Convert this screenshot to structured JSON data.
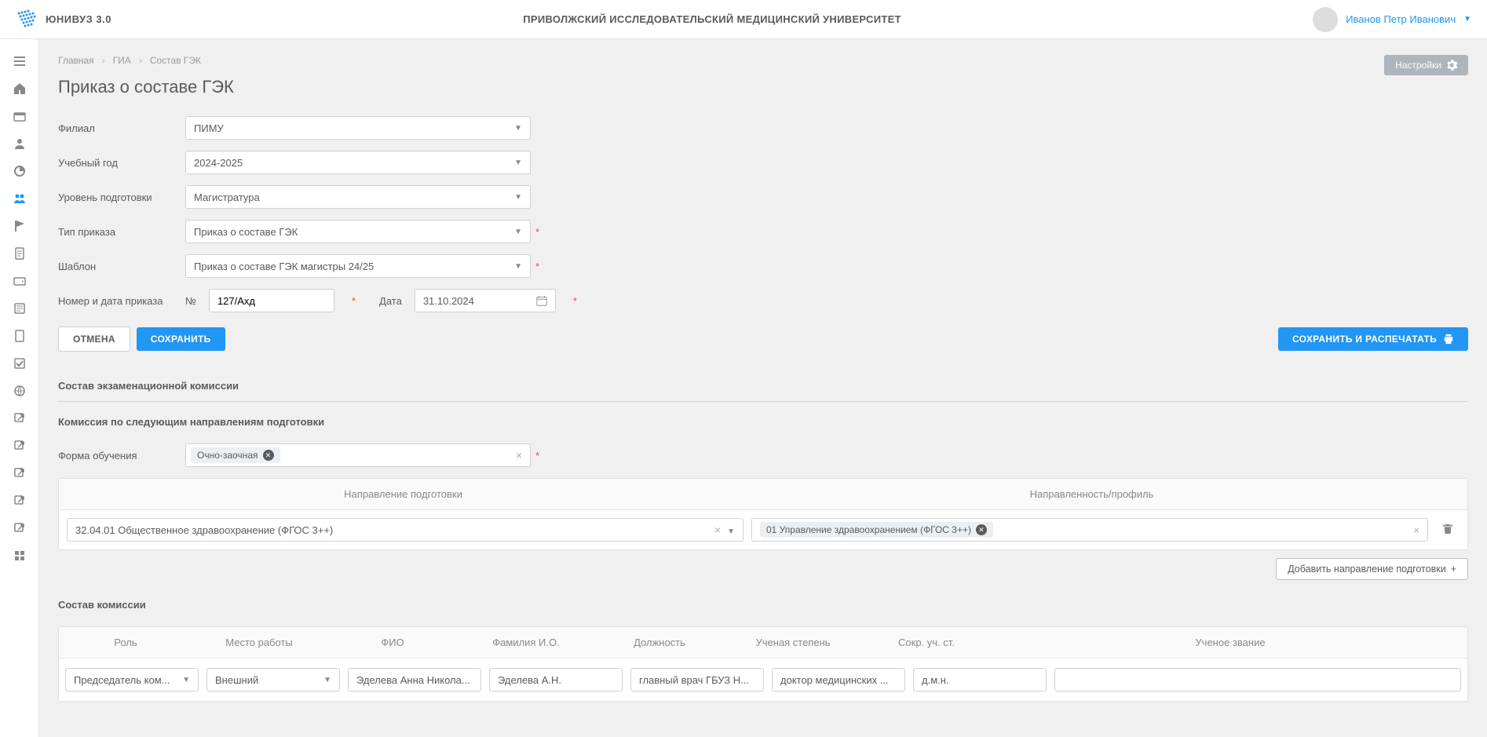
{
  "app": {
    "name": "ЮНИВУЗ 3.0",
    "org": "ПРИВОЛЖСКИЙ ИССЛЕДОВАТЕЛЬСКИЙ МЕДИЦИНСКИЙ УНИВЕРСИТЕТ"
  },
  "user": {
    "name": "Иванов Петр Иванович"
  },
  "breadcrumb": {
    "home": "Главная",
    "gia": "ГИА",
    "current": "Состав ГЭК"
  },
  "settings_btn": "Настройки",
  "page_title": "Приказ о составе ГЭК",
  "form": {
    "branch_label": "Филиал",
    "branch_value": "ПИМУ",
    "year_label": "Учебный год",
    "year_value": "2024-2025",
    "level_label": "Уровень подготовки",
    "level_value": "Магистратура",
    "type_label": "Тип приказа",
    "type_value": "Приказ о составе ГЭК",
    "template_label": "Шаблон",
    "template_value": "Приказ о составе ГЭК магистры 24/25",
    "num_date_label": "Номер и дата приказа",
    "num_prefix": "№",
    "num_value": "127/Ахд",
    "date_label": "Дата",
    "date_value": "31.10.2024"
  },
  "buttons": {
    "cancel": "ОТМЕНА",
    "save": "СОХРАНИТЬ",
    "save_print": "СОХРАНИТЬ И РАСПЕЧАТАТЬ"
  },
  "section_composition": "Состав экзаменационной комиссии",
  "subsection_directions": "Комиссия по следующим направлениям подготовки",
  "study_form_label": "Форма обучения",
  "study_form_tag": "Очно-заочная",
  "dir_table": {
    "col1": "Направление подготовки",
    "col2": "Направленность/профиль",
    "row1_dir": "32.04.01 Общественное здравоохранение (ФГОС 3++)",
    "row1_profile": "01 Управление здравоохранением (ФГОС 3++)"
  },
  "add_direction": "Добавить направление подготовки",
  "committee": {
    "title": "Состав комиссии",
    "cols": {
      "role": "Роль",
      "place": "Место работы",
      "fio": "ФИО",
      "short": "Фамилия И.О.",
      "pos": "Должность",
      "degree": "Ученая степень",
      "sdeg": "Сокр. уч. ст.",
      "rank": "Ученое звание"
    },
    "row": {
      "role": "Председатель ком...",
      "place": "Внешний",
      "fio": "Эделева Анна Никола...",
      "short": "Эделева А.Н.",
      "pos": "главный врач ГБУЗ Н...",
      "degree": "доктор медицинских ...",
      "sdeg": "д.м.н.",
      "rank": ""
    }
  }
}
